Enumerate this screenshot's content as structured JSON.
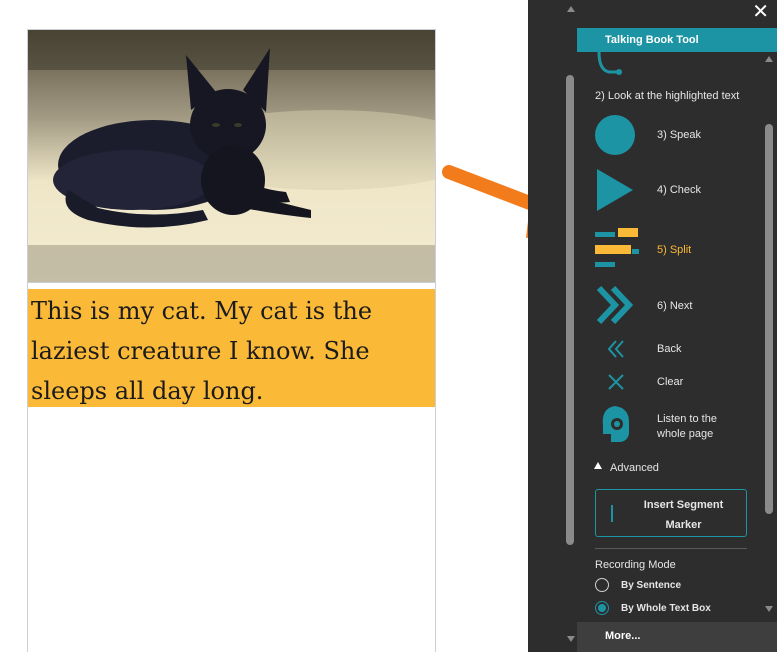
{
  "page": {
    "sentence": "This is my cat. My cat is the laziest creature I know. She sleeps all day long.",
    "lines": [
      "This is my cat. My cat is the",
      "laziest creature I know. She",
      "sleeps all day long."
    ],
    "highlight_color": "#fbb938",
    "photo_icon": "black-cat-photo"
  },
  "panel": {
    "title": "Talking Book Tool",
    "close_icon": "close-icon",
    "step2": "2) Look at the highlighted text",
    "speak": "3) Speak",
    "check": "4) Check",
    "split": "5) Split",
    "next": "6) Next",
    "back": "Back",
    "clear": "Clear",
    "listen_line1": "Listen to the",
    "listen_line2": "whole page",
    "advanced": "Advanced",
    "insert_line1": "Insert Segment",
    "insert_line2": "Marker",
    "recording_mode": "Recording Mode",
    "by_sentence": "By Sentence",
    "by_whole_text_box": "By Whole Text Box",
    "selected_mode": "By Whole Text Box",
    "more": "More..."
  },
  "colors": {
    "accent": "#1d94a4",
    "split_active": "#fbb938",
    "panel_bg": "#2d2d2d",
    "arrow": "#f27c1c"
  }
}
